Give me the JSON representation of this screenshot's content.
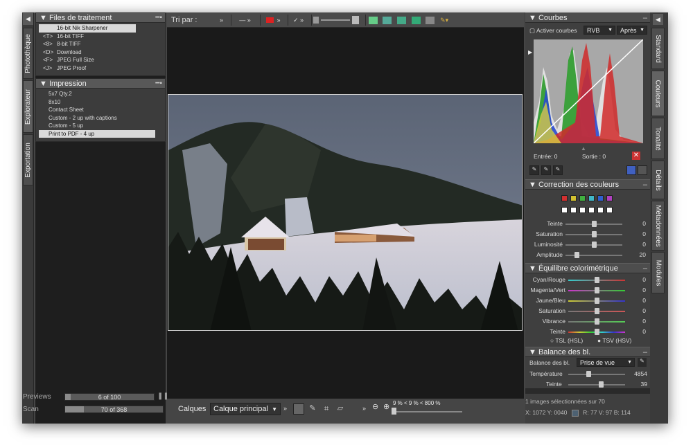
{
  "left_tabs": [
    "Photothèque",
    "Explorateur",
    "Exportation"
  ],
  "processing": {
    "title": "Files de traitement",
    "items": [
      {
        "key": "",
        "label": "16-bit Nik Sharpener",
        "selected": true
      },
      {
        "key": "<T>",
        "label": "16-bit TIFF"
      },
      {
        "key": "<8>",
        "label": "8-bit TIFF"
      },
      {
        "key": "<D>",
        "label": "Download"
      },
      {
        "key": "<F>",
        "label": "JPEG Full Size"
      },
      {
        "key": "<J>",
        "label": "JPEG Proof"
      }
    ]
  },
  "print": {
    "title": "Impression",
    "items": [
      {
        "label": "5x7 Qty.2"
      },
      {
        "label": "8x10"
      },
      {
        "label": "Contact Sheet"
      },
      {
        "label": "Custom - 2 up with captions"
      },
      {
        "label": "Custom - 5 up"
      },
      {
        "label": "Print to PDF - 4 up",
        "selected": true
      }
    ]
  },
  "status": {
    "previews_label": "Previews",
    "previews_value": "6 of 100",
    "previews_progress": 0.06,
    "scan_label": "Scan",
    "scan_value": "70 of 368",
    "scan_progress": 0.19
  },
  "toolbar": {
    "sort_label": "Tri par :",
    "chevron": "»"
  },
  "bottom": {
    "layers_label": "Calques",
    "layer_select": "Calque principal",
    "zoom_text": "9 % < 9 % < 800 %"
  },
  "curves": {
    "title": "Courbes",
    "enable_label": "Activer courbes",
    "channel": "RVB",
    "mode": "Après",
    "input_label": "Entrée:",
    "input_value": "0",
    "output_label": "Sortie :",
    "output_value": "0"
  },
  "color_correction": {
    "title": "Correction des couleurs",
    "swatches": [
      "#d23030",
      "#d2c030",
      "#40b040",
      "#40b8c8",
      "#3060d0",
      "#b040c0"
    ],
    "sliders": [
      {
        "label": "Teinte",
        "value": "0",
        "pos": 0.5
      },
      {
        "label": "Saturation",
        "value": "0",
        "pos": 0.5
      },
      {
        "label": "Luminosité",
        "value": "0",
        "pos": 0.5
      },
      {
        "label": "Amplitude",
        "value": "20",
        "pos": 0.2
      }
    ]
  },
  "balance": {
    "title": "Équilibre colorimétrique",
    "sliders": [
      {
        "label": "Cyan/Rouge",
        "value": "0"
      },
      {
        "label": "Magenta/Vert",
        "value": "0"
      },
      {
        "label": "Jaune/Bleu",
        "value": "0"
      },
      {
        "label": "Saturation",
        "value": "0"
      },
      {
        "label": "Vibrance",
        "value": "0"
      },
      {
        "label": "Teinte",
        "value": "0"
      }
    ],
    "radio1": "TSL (HSL)",
    "radio2": "TSV (HSV)"
  },
  "white_balance": {
    "title": "Balance des bl.",
    "label": "Balance des bl.",
    "select": "Prise de vue",
    "temp_label": "Température",
    "temp_value": "4854",
    "tint_label": "Teinte",
    "tint_value": "39"
  },
  "right_tabs": [
    "Standard",
    "Couleurs",
    "Tonalité",
    "Détails",
    "Métadonnées",
    "Modules"
  ],
  "status_right": {
    "selection": "1 images sélectionnées sur 70",
    "coords": "X: 1072  Y: 0040",
    "r_label": "R",
    "r": "77",
    "v_label": "V",
    "v": "97",
    "b_label": "B",
    "b": "114"
  }
}
